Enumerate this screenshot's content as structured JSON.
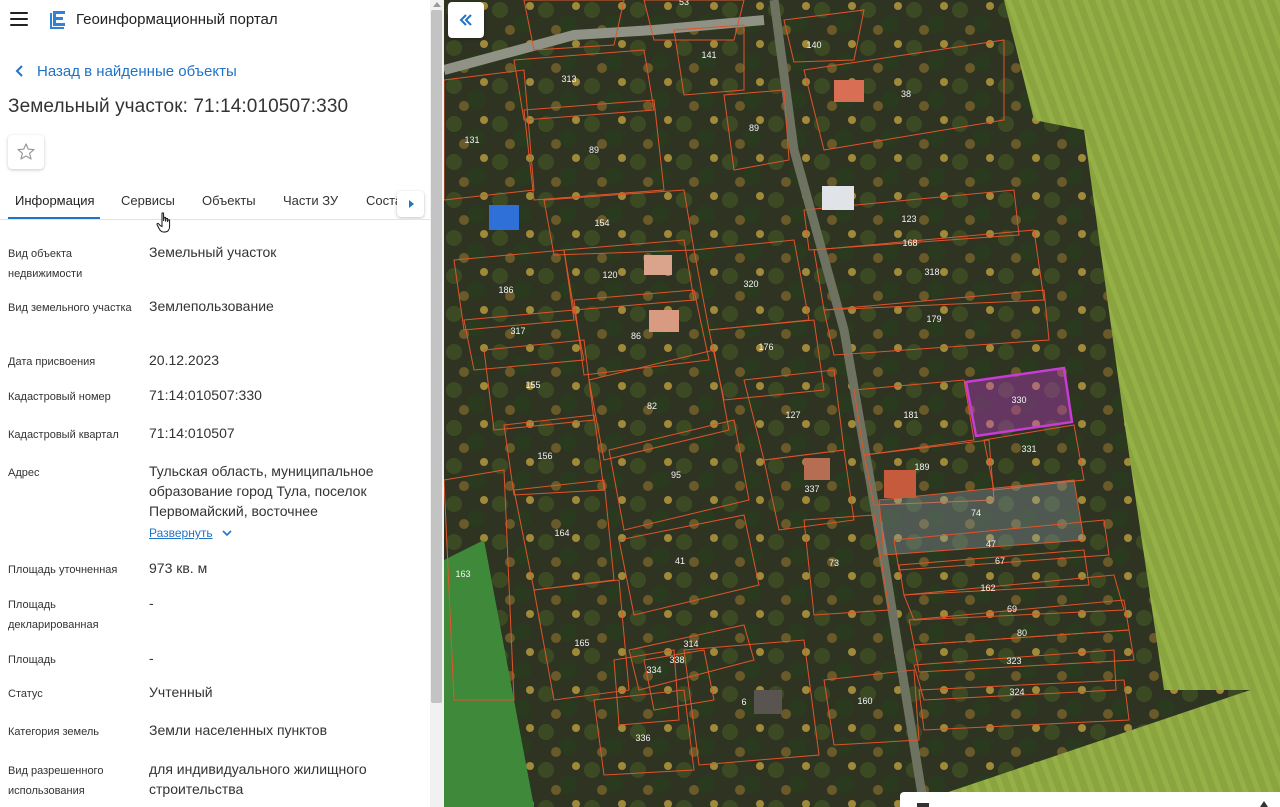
{
  "header": {
    "menu_icon": "hamburger-menu-icon",
    "logo_icon": "portal-logo-icon",
    "app_title": "Геоинформационный портал"
  },
  "nav": {
    "back_label": "Назад в найденные объекты"
  },
  "object": {
    "title": "Земельный участок: 71:14:010507:330"
  },
  "tabs": [
    {
      "label": "Информация",
      "active": true
    },
    {
      "label": "Сервисы",
      "active": false
    },
    {
      "label": "Объекты",
      "active": false
    },
    {
      "label": "Части ЗУ",
      "active": false
    },
    {
      "label": "Соста",
      "active": false
    }
  ],
  "fields": [
    {
      "label": "Вид объекта недвижимости",
      "value": "Земельный участок"
    },
    {
      "label": "Вид земельного участка",
      "value": "Землепользование"
    },
    {
      "label": "Дата присвоения",
      "value": "20.12.2023"
    },
    {
      "label": "Кадастровый номер",
      "value": "71:14:010507:330"
    },
    {
      "label": "Кадастровый квартал",
      "value": "71:14:010507"
    },
    {
      "label": "Адрес",
      "value": "Тульская область, муниципальное образование город Тула, поселок Первомайский, восточнее"
    },
    {
      "label": "Площадь уточненная",
      "value": "973 кв. м"
    },
    {
      "label": "Площадь декларированная",
      "value": "-"
    },
    {
      "label": "Площадь",
      "value": "-"
    },
    {
      "label": "Статус",
      "value": "Учтенный"
    },
    {
      "label": "Категория земель",
      "value": "Земли населенных пунктов"
    },
    {
      "label": "Вид разрешенного использования",
      "value": "для индивидуального жилищного строительства"
    }
  ],
  "expand_label": "Развернуть",
  "map": {
    "selected_parcel": "330",
    "parcel_labels": [
      "53",
      "140",
      "141",
      "313",
      "38",
      "89",
      "131",
      "89",
      "123",
      "168",
      "154",
      "318",
      "186",
      "320",
      "120",
      "179",
      "317",
      "86",
      "176",
      "155",
      "82",
      "330",
      "127",
      "181",
      "156",
      "95",
      "331",
      "189",
      "337",
      "74",
      "164",
      "47",
      "73",
      "41",
      "67",
      "163",
      "162",
      "69",
      "165",
      "80",
      "314",
      "338",
      "323",
      "334",
      "324",
      "160",
      "336",
      "6"
    ],
    "colors": {
      "parcel_border": "#e0542a",
      "selected_border": "#c83cd6",
      "field_green": "#7f9a3c"
    }
  },
  "icons": {
    "favorite": "star-icon",
    "collapse": "double-chevron-left-icon",
    "tabs_scroll": "chevron-right-icon",
    "expand": "chevron-down-icon"
  }
}
